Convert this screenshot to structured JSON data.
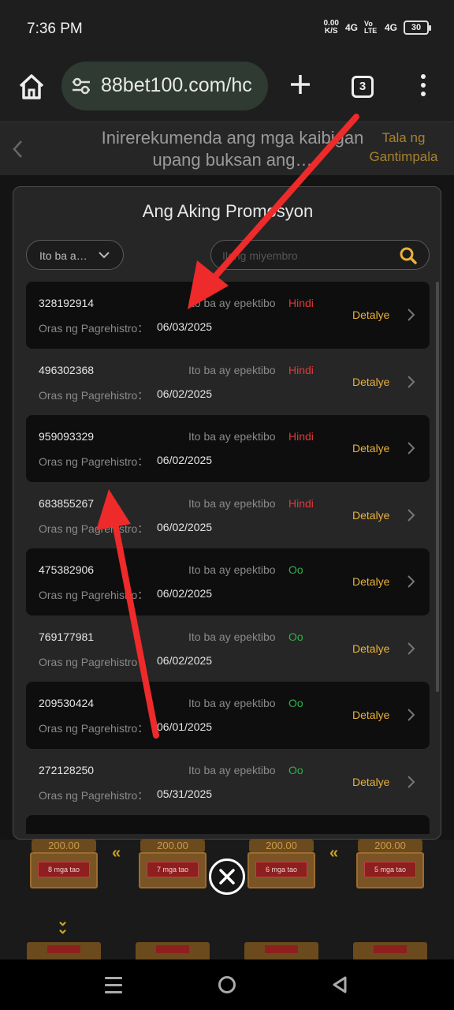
{
  "status_bar": {
    "time": "7:36 PM",
    "net_speed_value": "0.00",
    "net_speed_unit": "K/S",
    "signal1": "4G",
    "volte": "Vo LTE",
    "signal2": "4G",
    "battery": "30"
  },
  "browser": {
    "url": "88bet100.com/hc",
    "tab_count": "3",
    "icons": [
      "home-icon",
      "site-settings-icon",
      "plus-icon",
      "tabs-icon",
      "more-vert-icon"
    ]
  },
  "page_header": {
    "title": "Inirerekumenda ang mga kaibigan upang buksan ang…",
    "reward_link": "Tala ng Gantimpala"
  },
  "modal": {
    "title": "Ang Aking Promosyon",
    "filter_label": "Ito ba a…",
    "search_placeholder": "Ilang miyembro",
    "rows": [
      {
        "id": "328192914",
        "active_label": "Ito ba ay epektibo",
        "active_value": "Hindi",
        "active_state": "no",
        "reg_label": "Oras ng Pagrehistro：",
        "reg_date": "06/03/2025",
        "detail": "Detalye"
      },
      {
        "id": "496302368",
        "active_label": "Ito ba ay epektibo",
        "active_value": "Hindi",
        "active_state": "no",
        "reg_label": "Oras ng Pagrehistro：",
        "reg_date": "06/02/2025",
        "detail": "Detalye"
      },
      {
        "id": "959093329",
        "active_label": "Ito ba ay epektibo",
        "active_value": "Hindi",
        "active_state": "no",
        "reg_label": "Oras ng Pagrehistro：",
        "reg_date": "06/02/2025",
        "detail": "Detalye"
      },
      {
        "id": "683855267",
        "active_label": "Ito ba ay epektibo",
        "active_value": "Hindi",
        "active_state": "no",
        "reg_label": "Oras ng Pagrehistro：",
        "reg_date": "06/02/2025",
        "detail": "Detalye"
      },
      {
        "id": "475382906",
        "active_label": "Ito ba ay epektibo",
        "active_value": "Oo",
        "active_state": "yes",
        "reg_label": "Oras ng Pagrehistro：",
        "reg_date": "06/02/2025",
        "detail": "Detalye"
      },
      {
        "id": "769177981",
        "active_label": "Ito ba ay epektibo",
        "active_value": "Oo",
        "active_state": "yes",
        "reg_label": "Oras ng Pagrehistro：",
        "reg_date": "06/02/2025",
        "detail": "Detalye"
      },
      {
        "id": "209530424",
        "active_label": "Ito ba ay epektibo",
        "active_value": "Oo",
        "active_state": "yes",
        "reg_label": "Oras ng Pagrehistro：",
        "reg_date": "06/01/2025",
        "detail": "Detalye"
      },
      {
        "id": "272128250",
        "active_label": "Ito ba ay epektibo",
        "active_value": "Oo",
        "active_state": "yes",
        "reg_label": "Oras ng Pagrehistro：",
        "reg_date": "05/31/2025",
        "detail": "Detalye"
      }
    ]
  },
  "background_chests": [
    {
      "amount": "200.00",
      "label": "8 mga tao"
    },
    {
      "amount": "200.00",
      "label": "7 mga tao"
    },
    {
      "amount": "200.00",
      "label": "6 mga tao"
    },
    {
      "amount": "200.00",
      "label": "5 mga tao"
    }
  ],
  "colors": {
    "accent_gold": "#e9b23a",
    "status_no": "#e03a3a",
    "status_yes": "#2fb14a",
    "annotation_red": "#ee2a2a"
  },
  "nav_bar": {
    "icons": [
      "recents-icon",
      "home-circle-icon",
      "back-triangle-icon"
    ]
  }
}
